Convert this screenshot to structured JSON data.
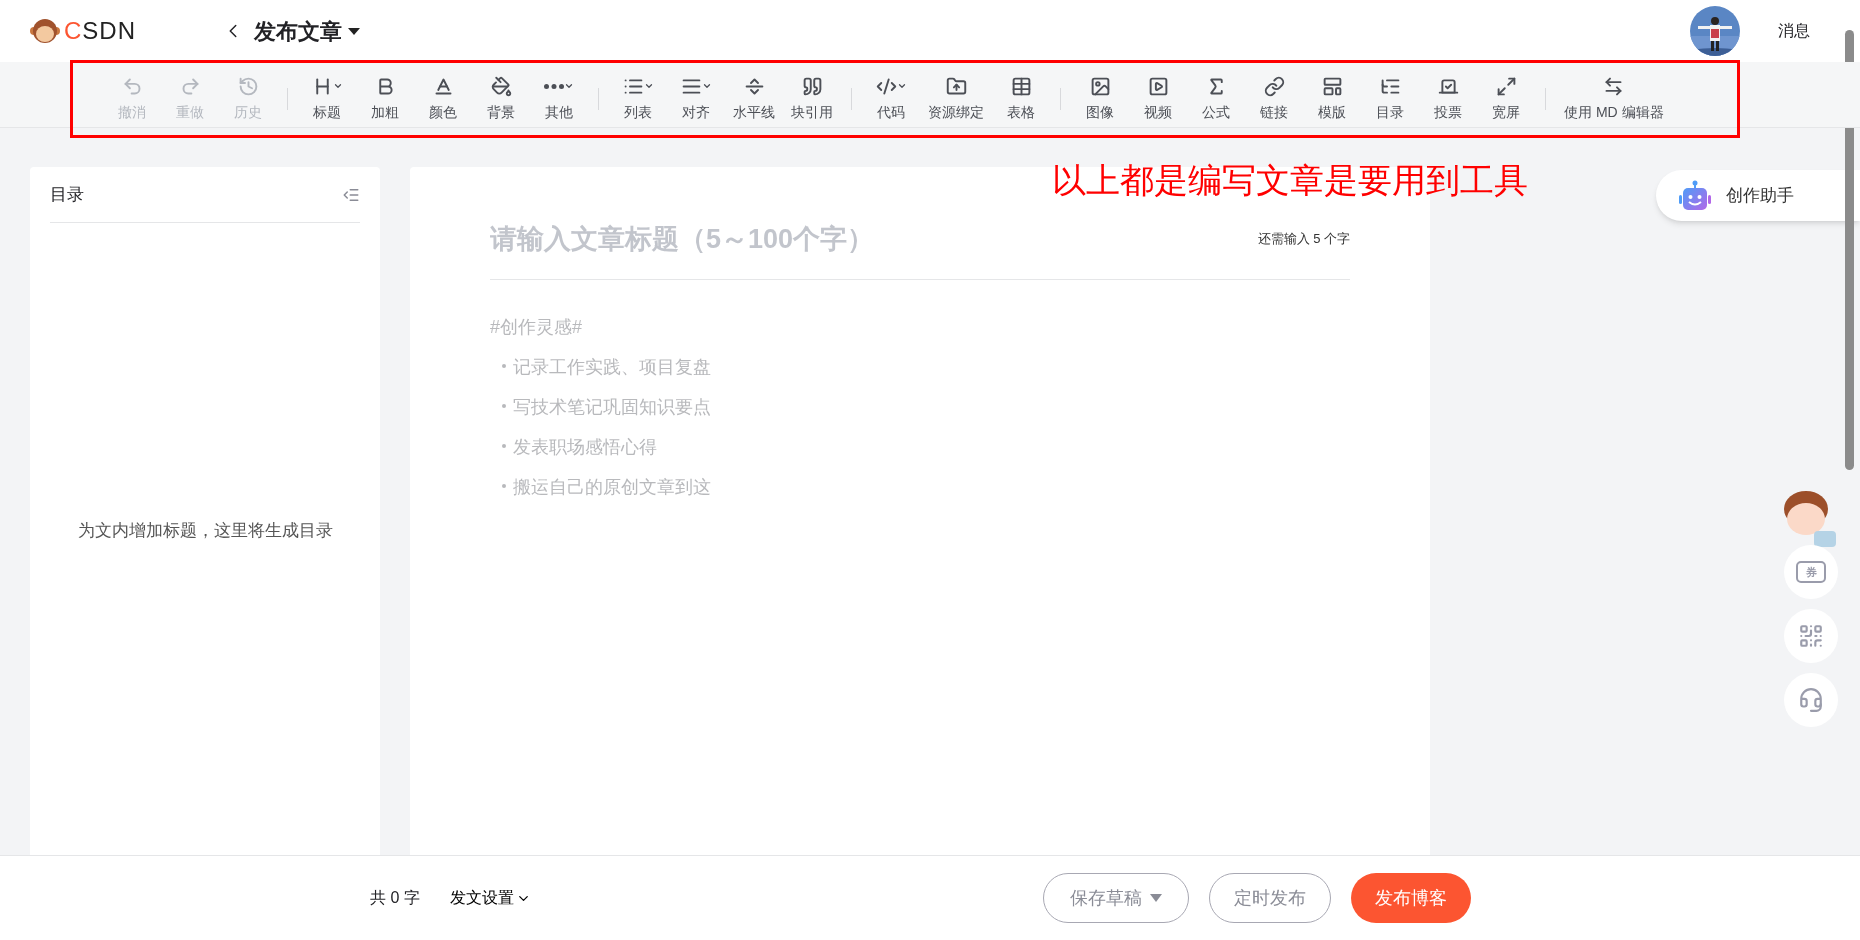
{
  "header": {
    "logo": "CSDN",
    "title": "发布文章",
    "messages": "消息"
  },
  "toolbar": {
    "groups": [
      [
        {
          "label": "撤消",
          "disabled": true,
          "dropdown": false
        },
        {
          "label": "重做",
          "disabled": true,
          "dropdown": false
        },
        {
          "label": "历史",
          "disabled": true,
          "dropdown": false
        }
      ],
      [
        {
          "label": "标题",
          "disabled": false,
          "dropdown": true
        },
        {
          "label": "加粗",
          "disabled": false,
          "dropdown": false
        },
        {
          "label": "颜色",
          "disabled": false,
          "dropdown": false
        },
        {
          "label": "背景",
          "disabled": false,
          "dropdown": false
        },
        {
          "label": "其他",
          "disabled": false,
          "dropdown": true
        }
      ],
      [
        {
          "label": "列表",
          "disabled": false,
          "dropdown": true
        },
        {
          "label": "对齐",
          "disabled": false,
          "dropdown": true
        },
        {
          "label": "水平线",
          "disabled": false,
          "dropdown": false
        },
        {
          "label": "块引用",
          "disabled": false,
          "dropdown": false
        }
      ],
      [
        {
          "label": "代码",
          "disabled": false,
          "dropdown": true
        },
        {
          "label": "资源绑定",
          "disabled": false,
          "dropdown": false
        },
        {
          "label": "表格",
          "disabled": false,
          "dropdown": false
        }
      ],
      [
        {
          "label": "图像",
          "disabled": false,
          "dropdown": false
        },
        {
          "label": "视频",
          "disabled": false,
          "dropdown": false
        },
        {
          "label": "公式",
          "disabled": false,
          "dropdown": false
        },
        {
          "label": "链接",
          "disabled": false,
          "dropdown": false
        },
        {
          "label": "模版",
          "disabled": false,
          "dropdown": false
        },
        {
          "label": "目录",
          "disabled": false,
          "dropdown": false
        },
        {
          "label": "投票",
          "disabled": false,
          "dropdown": false
        },
        {
          "label": "宽屏",
          "disabled": false,
          "dropdown": false
        }
      ],
      [
        {
          "label": "使用 MD 编辑器",
          "disabled": false,
          "dropdown": false
        }
      ]
    ]
  },
  "annotation": "以上都是编写文章是要用到工具",
  "toc": {
    "title": "目录",
    "empty_text": "为文内增加标题，这里将生成目录"
  },
  "editor": {
    "title_placeholder": "请输入文章标题（5～100个字）",
    "remaining": "还需输入 5 个字",
    "tag": "#创作灵感#",
    "bullets": [
      "记录工作实践、项目复盘",
      "写技术笔记巩固知识要点",
      "发表职场感悟心得",
      "搬运自己的原创文章到这"
    ]
  },
  "assistant": "创作助手",
  "coupon": "券",
  "footer": {
    "word_count": "共 0 字",
    "settings": "发文设置",
    "buttons": [
      {
        "label": "保存草稿",
        "kind": "outline-dropdown"
      },
      {
        "label": "定时发布",
        "kind": "outline"
      },
      {
        "label": "发布博客",
        "kind": "primary"
      }
    ]
  }
}
